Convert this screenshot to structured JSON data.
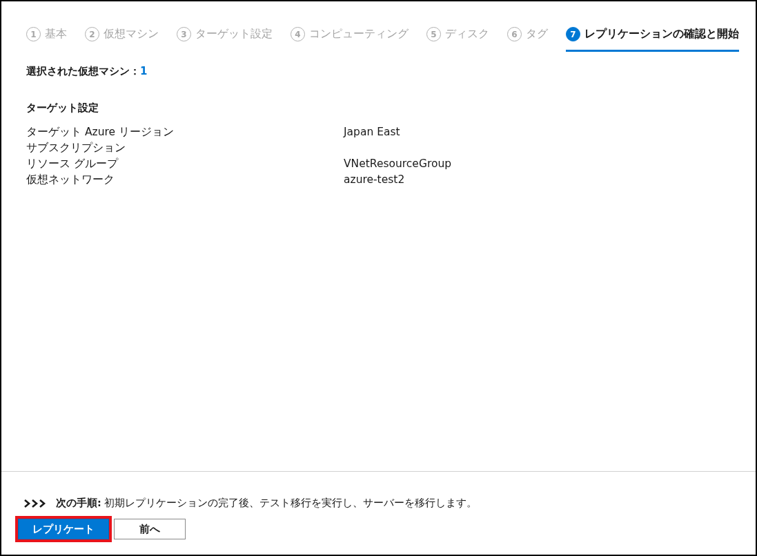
{
  "wizard_steps": [
    {
      "number": "1",
      "label": "基本",
      "selected": false
    },
    {
      "number": "2",
      "label": "仮想マシン",
      "selected": false
    },
    {
      "number": "3",
      "label": "ターゲット設定",
      "selected": false
    },
    {
      "number": "4",
      "label": "コンピューティング",
      "selected": false
    },
    {
      "number": "5",
      "label": "ディスク",
      "selected": false
    },
    {
      "number": "6",
      "label": "タグ",
      "selected": false
    },
    {
      "number": "7",
      "label": "レプリケーションの確認と開始",
      "selected": true
    }
  ],
  "summary": {
    "label": "選択された仮想マシン：",
    "value": "1"
  },
  "section": {
    "title": "ターゲット設定",
    "rows": [
      {
        "label": "ターゲット Azure リージョン",
        "value": "Japan East"
      },
      {
        "label": "サブスクリプション"
      },
      {
        "label": "リソース グループ",
        "value": "VNetResourceGroup"
      },
      {
        "label": "仮想ネットワーク",
        "value": "azure-test2"
      }
    ]
  },
  "next_step": {
    "text": "**次の手順:** 初期レプリケーションの完了後、テスト移行を実行し、サーバーを移行します。"
  },
  "buttons": [
    {
      "label": "レプリケート",
      "kind": "primary",
      "highlighted": true
    },
    {
      "label": "前へ",
      "kind": "secondary",
      "highlighted": false
    }
  ]
}
